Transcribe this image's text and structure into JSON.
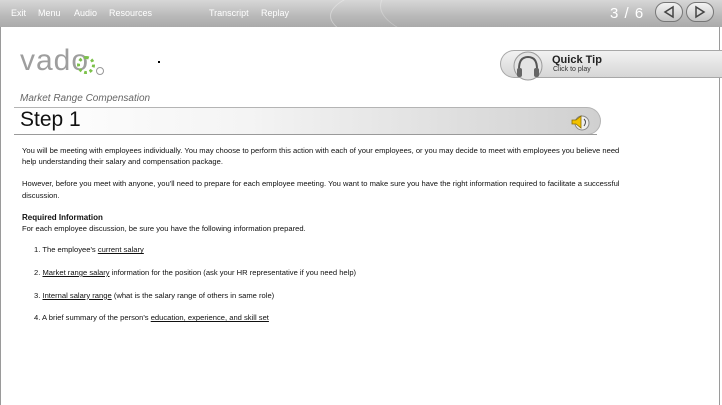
{
  "topnav": {
    "exit": "Exit",
    "menu": "Menu",
    "audio": "Audio",
    "resources": "Resources",
    "transcript": "Transcript",
    "replay": "Replay",
    "page_indicator": "3 / 6",
    "prev_icon": "triangle-left-icon",
    "next_icon": "triangle-right-icon"
  },
  "logo": {
    "text": "vado"
  },
  "quick_tip": {
    "title": "Quick Tip",
    "subtitle": "Click to play",
    "icon": "headphones-icon"
  },
  "section": {
    "title": "Market Range Compensation"
  },
  "step": {
    "title": "Step 1",
    "audio_icon": "speaker-icon"
  },
  "content": {
    "para1": "You will be meeting with employees individually. You may choose to perform this action with each of your employees, or you may decide to meet with employees you believe need help understanding their salary and compensation package.",
    "para2": "However, before you meet with anyone, you'll need to prepare for each employee meeting. You want to make sure you have the right information required to facilitate a successful discussion.",
    "required_heading": "Required Information",
    "required_intro": "For each employee discussion, be sure you have the following information prepared.",
    "items": [
      {
        "num": "1.",
        "pre": "The employee's ",
        "link": "current salary",
        "post": ""
      },
      {
        "num": "2.",
        "pre": "",
        "link": "Market range salary",
        "post": " information for the position (ask your HR representative if you need help)"
      },
      {
        "num": "3.",
        "pre": "",
        "link": "Internal salary range",
        "post": " (what is the salary range of others in same role)"
      },
      {
        "num": "4.",
        "pre": "A brief summary of the person's ",
        "link": "education, experience, and skill set",
        "post": ""
      }
    ]
  },
  "colors": {
    "topbar": "#bdbdbd",
    "logo_accent": "#7cc14a",
    "text": "#111111"
  }
}
